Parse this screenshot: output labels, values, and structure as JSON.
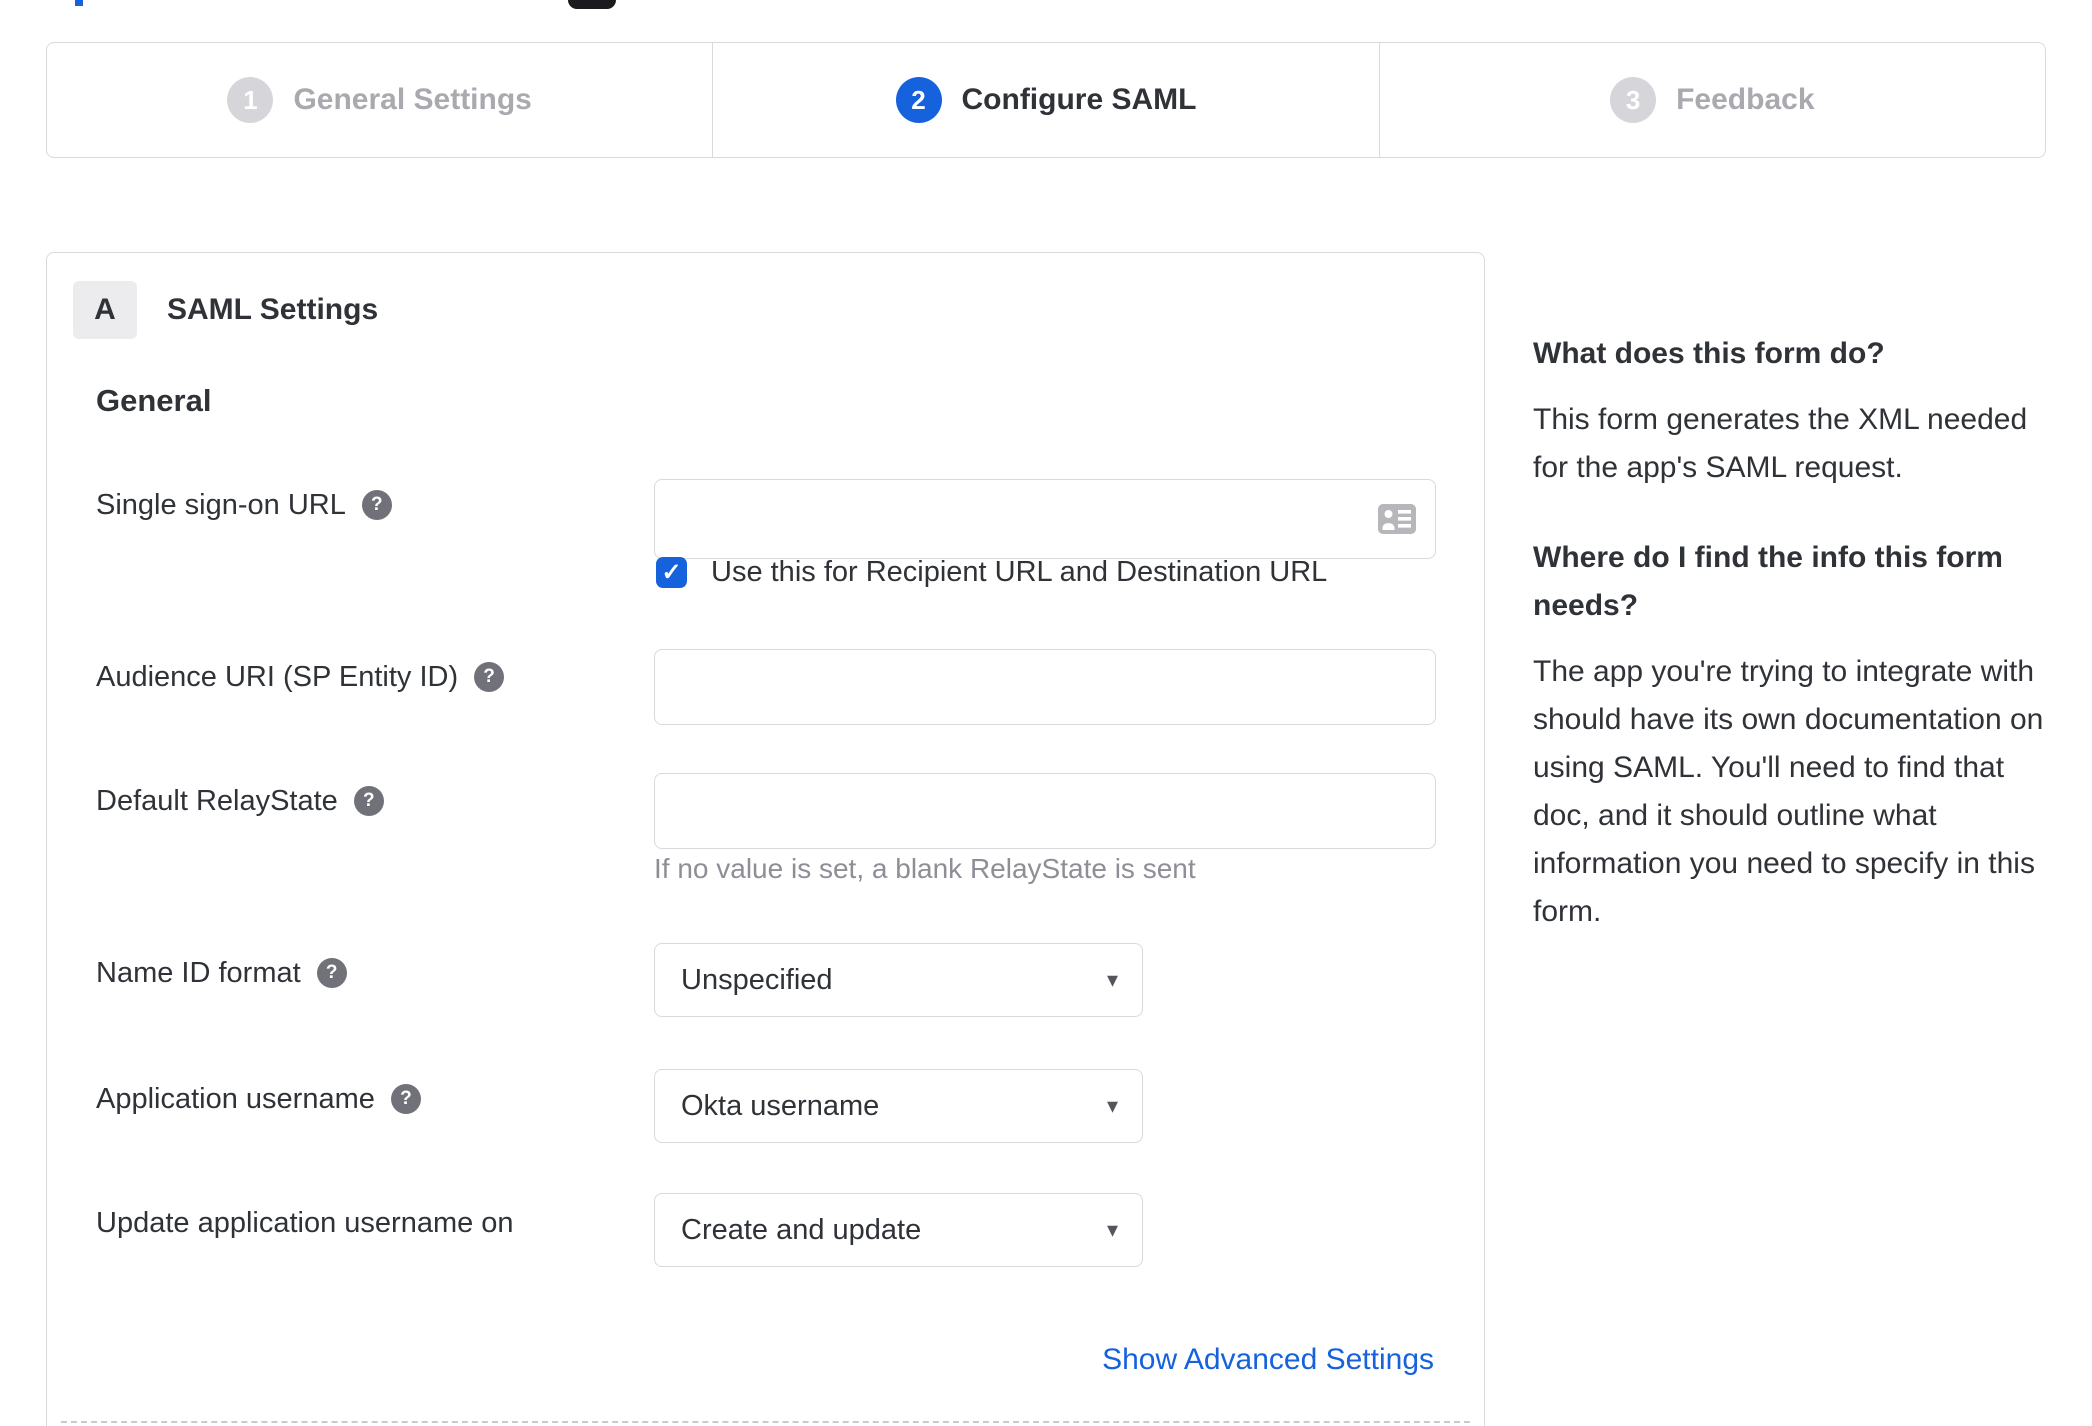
{
  "stepper": {
    "steps": [
      {
        "number": "1",
        "label": "General Settings",
        "state": "completed"
      },
      {
        "number": "2",
        "label": "Configure SAML",
        "state": "active"
      },
      {
        "number": "3",
        "label": "Feedback",
        "state": "upcoming"
      }
    ]
  },
  "panel": {
    "badge": "A",
    "title": "SAML Settings",
    "heading": "General",
    "rows": {
      "sso": {
        "label": "Single sign-on URL",
        "value": "",
        "checkbox_label": "Use this for Recipient URL and Destination URL",
        "checkbox_checked": true
      },
      "audience": {
        "label": "Audience URI (SP Entity ID)",
        "value": ""
      },
      "relay": {
        "label": "Default RelayState",
        "value": "",
        "helper": "If no value is set, a blank RelayState is sent"
      },
      "nameid": {
        "label": "Name ID format",
        "value": "Unspecified"
      },
      "appuser": {
        "label": "Application username",
        "value": "Okta username"
      },
      "updateuser": {
        "label": "Update application username on",
        "value": "Create and update"
      }
    },
    "advanced_link": "Show Advanced Settings"
  },
  "help": {
    "q1": "What does this form do?",
    "a1": "This form generates the XML needed for the app's SAML request.",
    "q2": "Where do I find the info this form needs?",
    "a2": "The app you're trying to integrate with should have its own documentation on using SAML. You'll need to find that doc, and it should outline what information you need to specify in this form."
  },
  "icons": {
    "help": "?",
    "caret": "▾",
    "check": "✓"
  },
  "colors": {
    "accent_blue": "#1662dd",
    "border": "#d9d9de",
    "text": "#2f3237",
    "muted_text": "#8e8e96",
    "inactive_step": "#d6d6da"
  }
}
